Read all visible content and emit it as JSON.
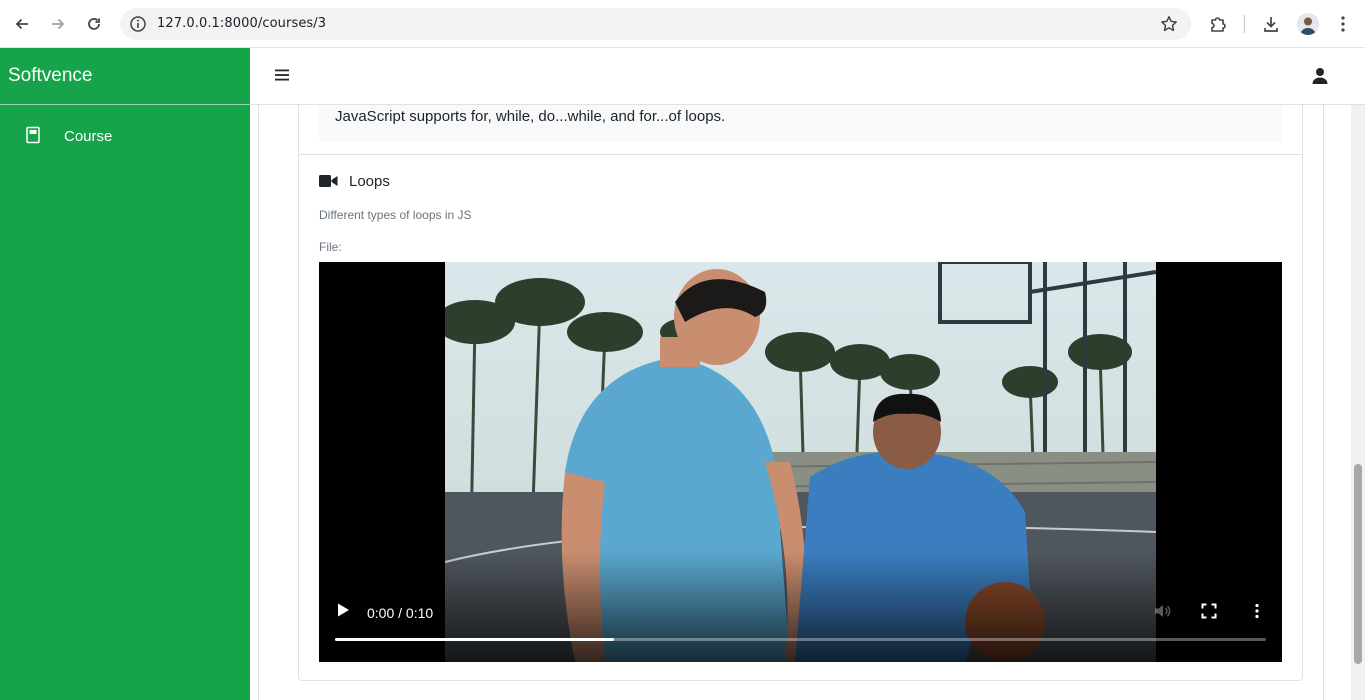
{
  "browser": {
    "url": "127.0.0.1:8000/courses/3",
    "back_icon": "back-arrow-icon",
    "forward_icon": "forward-arrow-icon",
    "reload_icon": "reload-icon",
    "site_info_icon": "site-info-icon",
    "bookmark_icon": "star-icon",
    "extensions_icon": "puzzle-icon",
    "downloads_icon": "download-icon",
    "menu_icon": "kebab-menu-icon"
  },
  "sidebar": {
    "brand": "Softvence",
    "items": [
      {
        "label": "Course",
        "icon": "book-icon"
      }
    ]
  },
  "header": {
    "menu_icon": "hamburger-icon",
    "user_icon": "user-icon"
  },
  "content": {
    "previous_lesson_text": "JavaScript supports for, while, do...while, and for...of loops.",
    "lesson": {
      "icon": "video-camera-icon",
      "title": "Loops",
      "description": "Different types of loops in JS",
      "file_label": "File:"
    },
    "video": {
      "time": "0:00 / 0:10",
      "progress": 0.3,
      "scene": "two people in blue t-shirts at an outdoor basketball court with palm trees"
    }
  },
  "colors": {
    "sidebar_bg": "#16a34a",
    "text_box_bg": "#f8f9fa",
    "border": "#dee2e6"
  }
}
